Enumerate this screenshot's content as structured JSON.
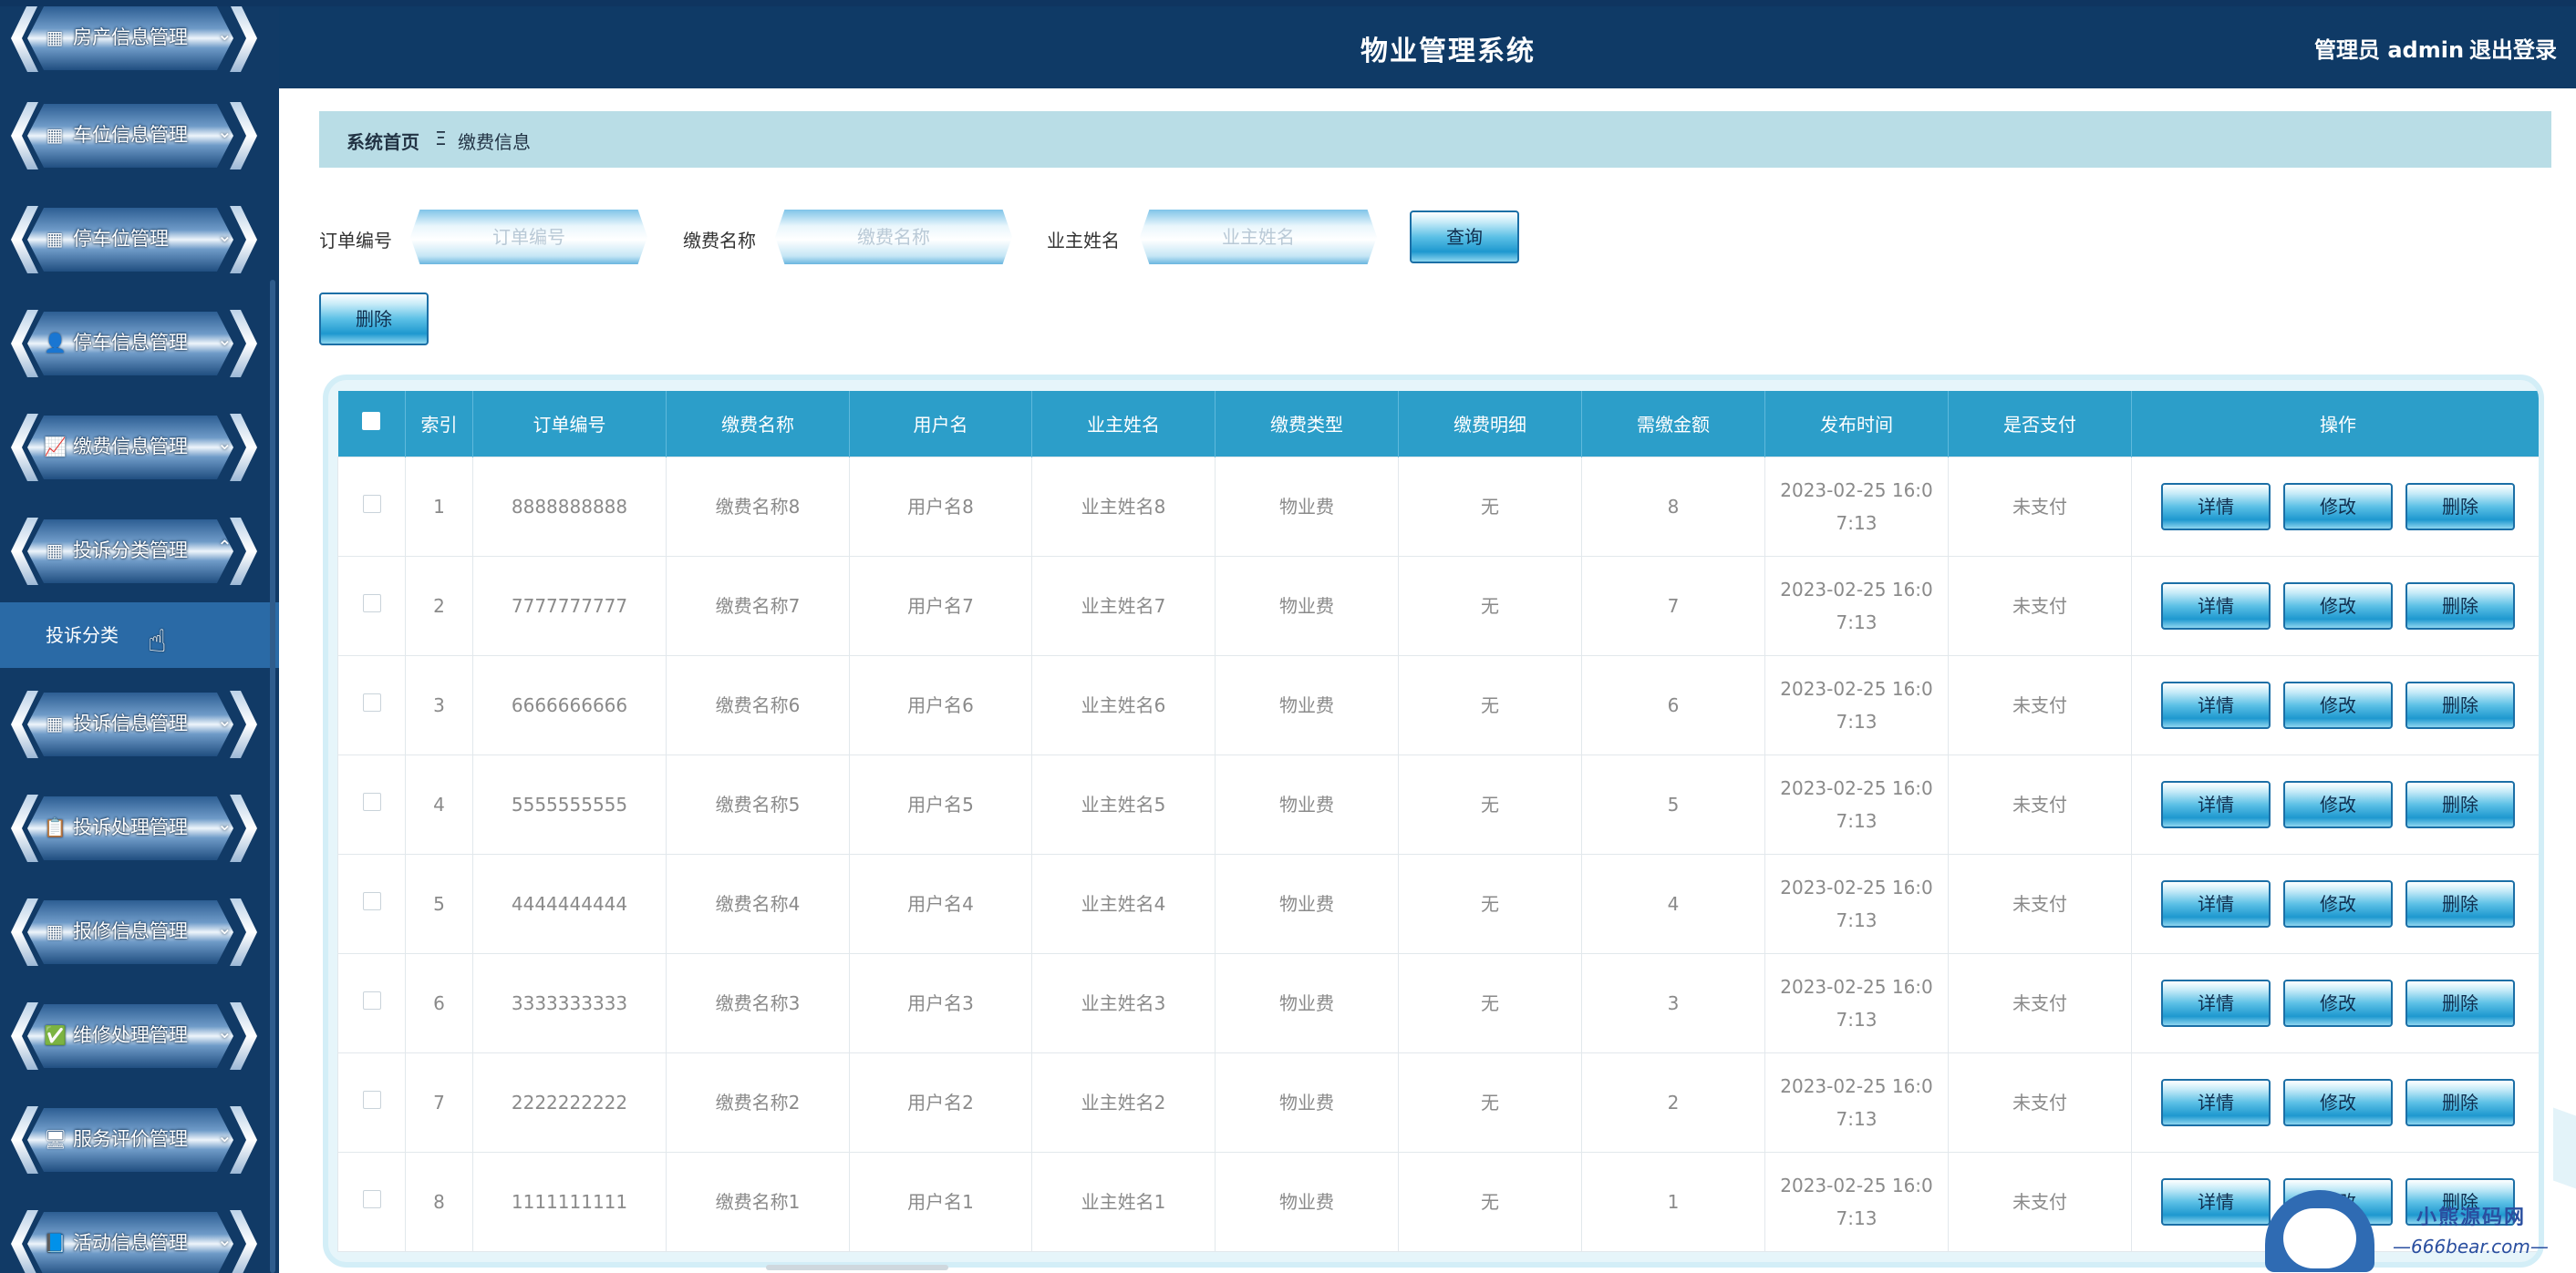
{
  "header": {
    "title": "物业管理系统",
    "user": "管理员 admin",
    "logout": "退出登录"
  },
  "sidebar": {
    "items": [
      {
        "label": "房产信息管理",
        "icon": "grid-icon"
      },
      {
        "label": "车位信息管理",
        "icon": "grid-icon"
      },
      {
        "label": "停车位管理",
        "icon": "grid-icon"
      },
      {
        "label": "停车信息管理",
        "icon": "user-icon"
      },
      {
        "label": "缴费信息管理",
        "icon": "chart-icon"
      },
      {
        "label": "投诉分类管理",
        "icon": "grid-icon",
        "expanded": true
      },
      {
        "label": "投诉信息管理",
        "icon": "grid-icon"
      },
      {
        "label": "投诉处理管理",
        "icon": "clipboard-icon"
      },
      {
        "label": "报修信息管理",
        "icon": "table-icon"
      },
      {
        "label": "维修处理管理",
        "icon": "clipboard-check-icon"
      },
      {
        "label": "服务评价管理",
        "icon": "monitor-icon"
      },
      {
        "label": "活动信息管理",
        "icon": "book-icon"
      }
    ],
    "submenu": {
      "label": "投诉分类"
    }
  },
  "breadcrumb": {
    "home": "系统首页",
    "sep": "Ξ",
    "current": "缴费信息"
  },
  "search": {
    "fields": [
      {
        "label": "订单编号",
        "placeholder": "订单编号"
      },
      {
        "label": "缴费名称",
        "placeholder": "缴费名称"
      },
      {
        "label": "业主姓名",
        "placeholder": "业主姓名"
      }
    ],
    "query_label": "查询",
    "delete_label": "删除"
  },
  "table": {
    "columns": [
      "索引",
      "订单编号",
      "缴费名称",
      "用户名",
      "业主姓名",
      "缴费类型",
      "缴费明细",
      "需缴金额",
      "发布时间",
      "是否支付",
      "操作"
    ],
    "rows": [
      {
        "index": "1",
        "order": "8888888888",
        "name": "缴费名称8",
        "user": "用户名8",
        "owner": "业主姓名8",
        "type": "物业费",
        "detail": "无",
        "amount": "8",
        "time": "2023-02-25 16:07:13",
        "paid": "未支付"
      },
      {
        "index": "2",
        "order": "7777777777",
        "name": "缴费名称7",
        "user": "用户名7",
        "owner": "业主姓名7",
        "type": "物业费",
        "detail": "无",
        "amount": "7",
        "time": "2023-02-25 16:07:13",
        "paid": "未支付"
      },
      {
        "index": "3",
        "order": "6666666666",
        "name": "缴费名称6",
        "user": "用户名6",
        "owner": "业主姓名6",
        "type": "物业费",
        "detail": "无",
        "amount": "6",
        "time": "2023-02-25 16:07:13",
        "paid": "未支付"
      },
      {
        "index": "4",
        "order": "5555555555",
        "name": "缴费名称5",
        "user": "用户名5",
        "owner": "业主姓名5",
        "type": "物业费",
        "detail": "无",
        "amount": "5",
        "time": "2023-02-25 16:07:13",
        "paid": "未支付"
      },
      {
        "index": "5",
        "order": "4444444444",
        "name": "缴费名称4",
        "user": "用户名4",
        "owner": "业主姓名4",
        "type": "物业费",
        "detail": "无",
        "amount": "4",
        "time": "2023-02-25 16:07:13",
        "paid": "未支付"
      },
      {
        "index": "6",
        "order": "3333333333",
        "name": "缴费名称3",
        "user": "用户名3",
        "owner": "业主姓名3",
        "type": "物业费",
        "detail": "无",
        "amount": "3",
        "time": "2023-02-25 16:07:13",
        "paid": "未支付"
      },
      {
        "index": "7",
        "order": "2222222222",
        "name": "缴费名称2",
        "user": "用户名2",
        "owner": "业主姓名2",
        "type": "物业费",
        "detail": "无",
        "amount": "2",
        "time": "2023-02-25 16:07:13",
        "paid": "未支付"
      },
      {
        "index": "8",
        "order": "1111111111",
        "name": "缴费名称1",
        "user": "用户名1",
        "owner": "业主姓名1",
        "type": "物业费",
        "detail": "无",
        "amount": "1",
        "time": "2023-02-25 16:07:13",
        "paid": "未支付"
      }
    ],
    "actions": {
      "detail": "详情",
      "edit": "修改",
      "delete": "删除"
    }
  },
  "watermark": {
    "line1": "小熊源码网",
    "line2": "—666bear.com—"
  },
  "colors": {
    "sidebar": "#113a66",
    "header": "#0f3a66",
    "table_header": "#2c9ec9",
    "breadcrumb": "#b9dde6"
  }
}
